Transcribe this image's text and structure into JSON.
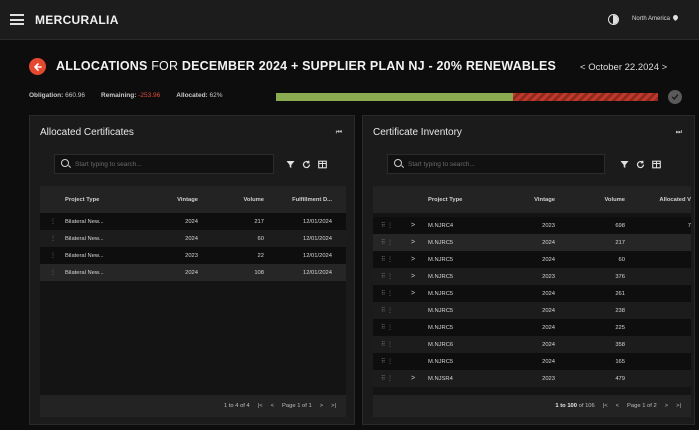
{
  "header": {
    "brand": "MERCURALIA",
    "region": "North America"
  },
  "title": {
    "part1": "ALLOCATIONS",
    "part2": " FOR ",
    "part3": "DECEMBER 2024 + SUPPLIER PLAN NJ - 20% RENEWABLES",
    "period": "October 22.2024"
  },
  "stats": {
    "obligation_label": "Obligation:",
    "obligation_value": "660.96",
    "remaining_label": "Remaining:",
    "remaining_value": "-253.96",
    "allocated_label": "Allocated:",
    "allocated_value": "62%",
    "allocated_fraction": 0.62,
    "over_fraction": 0.38
  },
  "left_panel": {
    "title": "Allocated Certificates",
    "search_placeholder": "Start typing to search...",
    "columns": [
      "Project Type",
      "Vintage",
      "Volume",
      "Fulfillment D..."
    ],
    "rows": [
      [
        "Bilateral New...",
        "2024",
        "217",
        "12/01/2024"
      ],
      [
        "Bilateral New...",
        "2024",
        "60",
        "12/01/2024"
      ],
      [
        "Bilateral New...",
        "2023",
        "22",
        "12/01/2024"
      ],
      [
        "Bilateral New...",
        "2024",
        "108",
        "12/01/2024"
      ]
    ],
    "footer_range": "1 to 4 of 4",
    "footer_page": "Page 1 of 1"
  },
  "right_panel": {
    "title": "Certificate Inventory",
    "search_placeholder": "Start typing to search...",
    "columns": [
      "Project Type",
      "Vintage",
      "Volume",
      "Allocated V"
    ],
    "rows": [
      {
        "expand": true,
        "type": "M.NJRC4",
        "vintage": "2023",
        "volume": "698",
        "allocated": "7"
      },
      {
        "expand": true,
        "type": "M.NJRC5",
        "vintage": "2024",
        "volume": "217",
        "allocated": ""
      },
      {
        "expand": true,
        "type": "M.NJRC5",
        "vintage": "2024",
        "volume": "60",
        "allocated": ""
      },
      {
        "expand": true,
        "type": "M.NJRC5",
        "vintage": "2023",
        "volume": "376",
        "allocated": ""
      },
      {
        "expand": true,
        "type": "M.NJRC5",
        "vintage": "2024",
        "volume": "261",
        "allocated": ""
      },
      {
        "expand": false,
        "type": "M.NJRC5",
        "vintage": "2024",
        "volume": "238",
        "allocated": ""
      },
      {
        "expand": false,
        "type": "M.NJRC5",
        "vintage": "2024",
        "volume": "225",
        "allocated": ""
      },
      {
        "expand": false,
        "type": "M.NJRC6",
        "vintage": "2024",
        "volume": "358",
        "allocated": ""
      },
      {
        "expand": false,
        "type": "M.NJRC5",
        "vintage": "2024",
        "volume": "165",
        "allocated": ""
      },
      {
        "expand": true,
        "type": "M.NJSR4",
        "vintage": "2023",
        "volume": "479",
        "allocated": ""
      }
    ],
    "footer_range_start": "1 to 100",
    "footer_range_of": "of 106",
    "footer_page": "Page 1 of 2"
  },
  "colors": {
    "accent_red": "#e4482f",
    "progress_green": "#8aab50",
    "progress_red": "#c0392b"
  }
}
